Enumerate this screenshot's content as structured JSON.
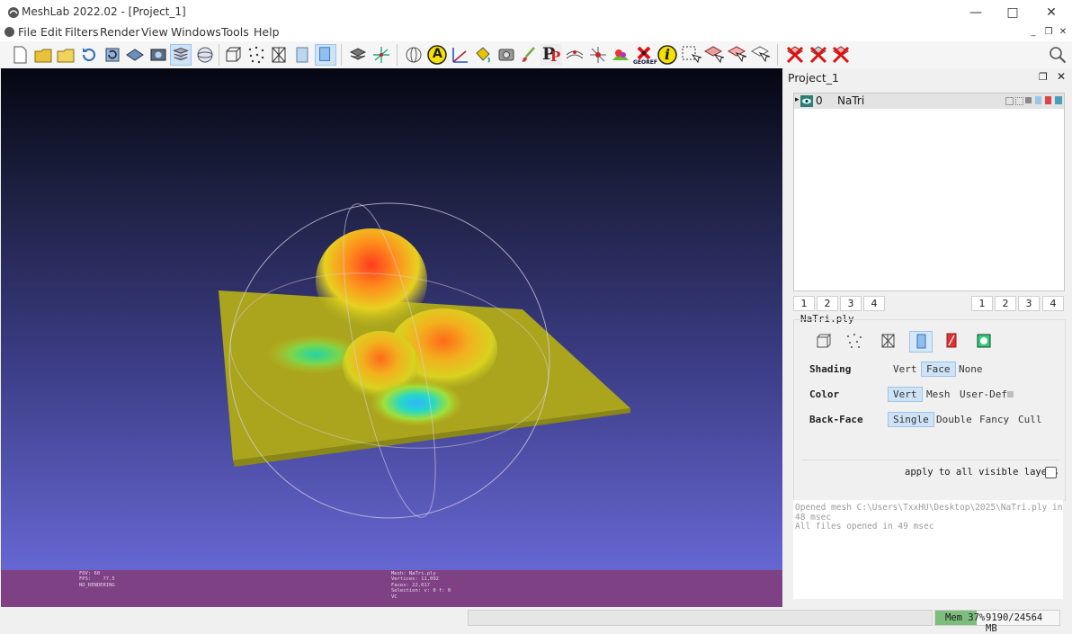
{
  "window": {
    "title": "MeshLab 2022.02 - [Project_1]",
    "min_icon": "minimize-icon",
    "max_icon": "maximize-icon",
    "close_icon": "close-icon"
  },
  "menu": [
    "File",
    "Edit",
    "Filters",
    "Render",
    "View",
    "Windows",
    "Tools",
    "Help"
  ],
  "toolbar": {
    "icons": [
      "new-document-icon",
      "open-folder-icon",
      "open-project-icon",
      "reload-icon",
      "reload-all-icon",
      "save-icon",
      "snapshot-icon",
      "layers-icon",
      "globe-light-icon",
      "bounding-box-icon",
      "points-icon",
      "wireframe-icon",
      "flat-shading-icon",
      "smooth-shading-icon",
      "layer-stack-icon",
      "axes-icon",
      "sphere-icon",
      "annotation-a-icon",
      "measure-axes-icon",
      "paint-bucket-icon",
      "camera-icon",
      "brush-icon",
      "pickpoints-p-icon",
      "align-icon",
      "edit-select-icon",
      "painter-icon",
      "georef-icon",
      "info-icon",
      "select-vertices-icon",
      "select-faces-icon",
      "select-connected-icon",
      "select-cursor-icon",
      "delete-selection-icon",
      "delete-vertices-icon",
      "delete-faces-icon"
    ],
    "georef_label": "GEOREF",
    "annotation_label": "A",
    "info_label": "i",
    "pp_label": "P"
  },
  "viewport": {
    "info_left": "FOV: 60\nFPS:    77.5\nNO_RENDERING",
    "info_right": "Mesh: NaTri.ply\nVertices: 11,092\nFaces: 22,017\nSelection: v: 0 f: 0\nVC"
  },
  "panel": {
    "title": "Project_1",
    "float_icon": "float-panel-icon",
    "close_icon": "close-panel-icon",
    "layer": {
      "index": "0",
      "name": "NaTri"
    },
    "left_tabs": [
      "1",
      "2",
      "3",
      "4"
    ],
    "right_tabs": [
      "1",
      "2",
      "3",
      "4"
    ],
    "mesh_group_title": "NaTri.ply",
    "shading": {
      "label": "Shading",
      "options": [
        "Vert",
        "Face",
        "None"
      ],
      "selected": "Face"
    },
    "color": {
      "label": "Color",
      "options": [
        "Vert",
        "Mesh",
        "User-Def"
      ],
      "selected": "Vert"
    },
    "backface": {
      "label": "Back-Face",
      "options": [
        "Single",
        "Double",
        "Fancy",
        "Cull"
      ],
      "selected": "Single"
    },
    "apply_all": "apply to all visible layers",
    "log": [
      "Opened mesh C:\\Users\\TxxHU\\Desktop\\2025\\NaTri.ply in",
      "48 msec",
      "All files opened in 49 msec"
    ]
  },
  "status": {
    "mem_label": "Mem 37%",
    "mem_value": "9190/24564 MB",
    "mem_fraction": 0.37
  },
  "colors": {
    "accent_sel": "#cfe3f7",
    "infobar": "#7e4183",
    "mem_fill": "#7dbd7d"
  }
}
